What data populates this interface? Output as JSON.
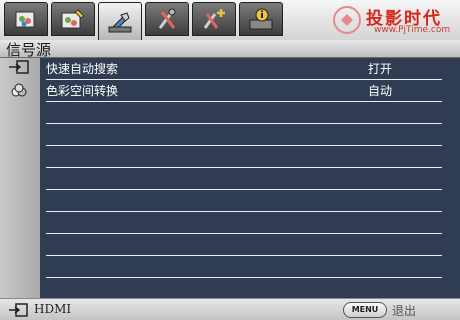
{
  "tabs": [
    {
      "icon": "picture-icon",
      "active": false
    },
    {
      "icon": "picture-advanced-icon",
      "active": false
    },
    {
      "icon": "source-settings-icon",
      "active": true
    },
    {
      "icon": "tools-icon",
      "active": false
    },
    {
      "icon": "tools-advanced-icon",
      "active": false
    },
    {
      "icon": "information-icon",
      "active": false
    }
  ],
  "watermark": {
    "title": "投影时代",
    "url": "www.PjTime.com"
  },
  "menu": {
    "title": "信号源",
    "items": [
      {
        "label": "快速自动搜索",
        "value": "打开"
      },
      {
        "label": "色彩空间转换",
        "value": "自动"
      }
    ]
  },
  "footer": {
    "source": "HDMI",
    "menu_button": "MENU",
    "exit_label": "退出"
  },
  "colors": {
    "panel_background": "#2f3c52",
    "watermark_red": "#d9261c"
  }
}
